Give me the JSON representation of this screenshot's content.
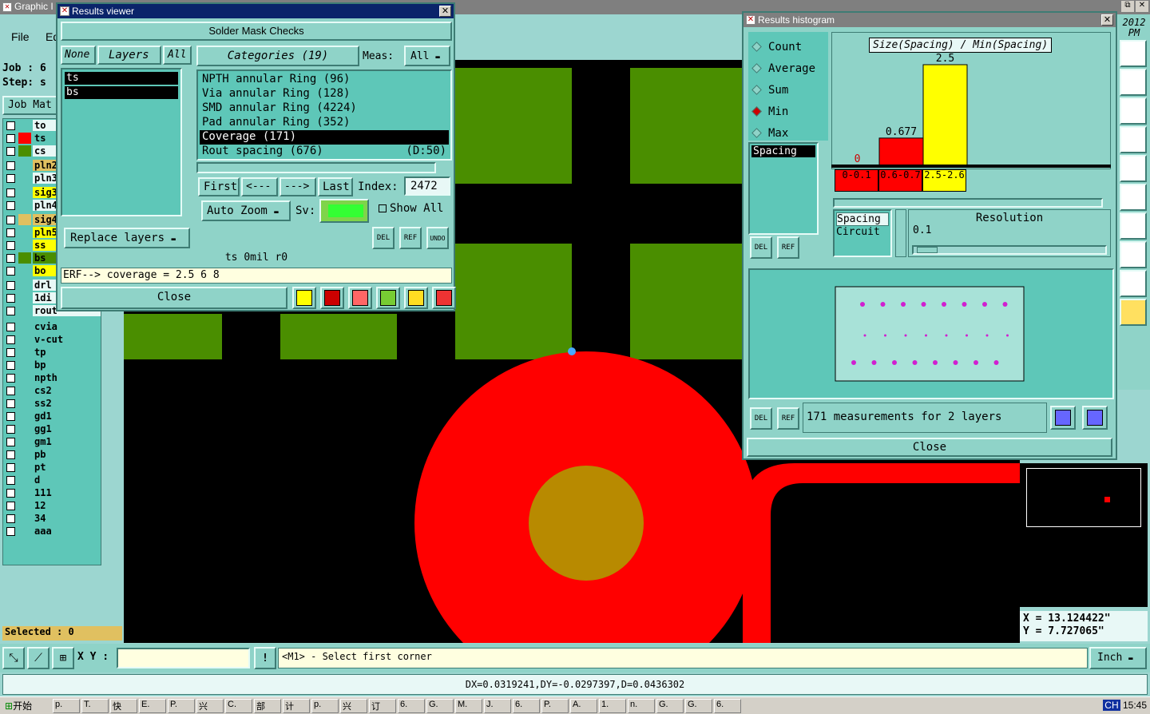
{
  "main": {
    "title": "Graphic I",
    "menu_file": "File",
    "menu_edit": "Ed",
    "job_label": "Job : 6",
    "step_label": "Step: s",
    "job_matrix": "Job Mat",
    "layers": [
      "to",
      "ts",
      "cs",
      "pln2",
      "pln3",
      "sig3",
      "pln4",
      "sig4",
      "pln5",
      "ss",
      "bs",
      "bo",
      "drl",
      "1di",
      "rout",
      "cvia",
      "v-cut",
      "tp",
      "bp",
      "npth",
      "cs2",
      "ss2",
      "gd1",
      "gg1",
      "gm1",
      "pb",
      "pt",
      "d",
      "111",
      "12",
      "34",
      "aaa"
    ],
    "selected": "Selected : 0",
    "xy_label": "X Y :",
    "status_msg": "<M1> - Select first corner",
    "units": "Inch",
    "coord_x": "X = 13.124422\"",
    "coord_y": "Y = 7.727065\"",
    "delta": "DX=0.0319241,DY=-0.0297397,D=0.0436302",
    "clock_top": "2012",
    "clock_pm": "PM"
  },
  "results_viewer": {
    "title": "Results viewer",
    "heading": "Solder Mask Checks",
    "none": "None",
    "layers_btn": "Layers",
    "all_btn": "All",
    "selected_layers": [
      "ts",
      "bs"
    ],
    "categories_btn": "Categories (19)",
    "meas_label": "Meas:",
    "meas_value": "All",
    "categories": [
      {
        "label": "NPTH annular Ring (96)",
        "extra": ""
      },
      {
        "label": "Via annular Ring (128)",
        "extra": ""
      },
      {
        "label": "SMD annular Ring (4224)",
        "extra": ""
      },
      {
        "label": "Pad annular Ring (352)",
        "extra": ""
      },
      {
        "label": "Coverage (171)",
        "extra": ""
      },
      {
        "label": "Rout spacing (676)",
        "extra": "(D:50)"
      }
    ],
    "first": "First",
    "prev": "<---",
    "next": "--->",
    "last": "Last",
    "index_label": "Index:",
    "index_value": "2472",
    "auto_zoom": "Auto Zoom",
    "sv_label": "Sv:",
    "show_all": "Show All",
    "replace_layers": "Replace layers",
    "del": "DEL",
    "ref": "REF",
    "undo": "UNDO",
    "info_line": "ts 0mil  r0",
    "erf_line": "ERF--> coverage = 2.5 6 8",
    "close": "Close"
  },
  "histogram": {
    "title": "Results histogram",
    "modes": [
      "Count",
      "Average",
      "Sum",
      "Min",
      "Max"
    ],
    "selected_mode": "Min",
    "spacing_item": "Spacing",
    "chart_title": "Size(Spacing) / Min(Spacing)",
    "bins": [
      {
        "range": "0-0.1",
        "value": "0",
        "color": "#ff0000"
      },
      {
        "range": "0.6-0.7",
        "value": "0.677",
        "color": "#ff0000"
      },
      {
        "range": "2.5-2.6",
        "value": "2.5",
        "color": "#ffff00"
      }
    ],
    "left_list": [
      "Spacing",
      "Circuit"
    ],
    "resolution_label": "Resolution",
    "resolution_value": "0.1",
    "summary": "171 measurements for 2 layers",
    "close": "Close",
    "del": "DEL",
    "ref": "REF"
  },
  "chart_data": {
    "type": "bar",
    "title": "Size(Spacing) / Min(Spacing)",
    "categories": [
      "0-0.1",
      "0.6-0.7",
      "2.5-2.6"
    ],
    "values": [
      0,
      0.677,
      2.5
    ],
    "colors": [
      "#ff0000",
      "#ff0000",
      "#ffff00"
    ]
  },
  "taskbar": {
    "start": "开始",
    "items": [
      "p.",
      "T.",
      "快",
      "E.",
      "P.",
      "兴",
      "C.",
      "部",
      "计",
      "p.",
      "兴",
      "订",
      "6.",
      "G.",
      "M.",
      "J.",
      "6.",
      "P.",
      "A.",
      "1.",
      "n.",
      "G.",
      "G.",
      "6."
    ],
    "lang": "CH",
    "time": "15:45"
  }
}
